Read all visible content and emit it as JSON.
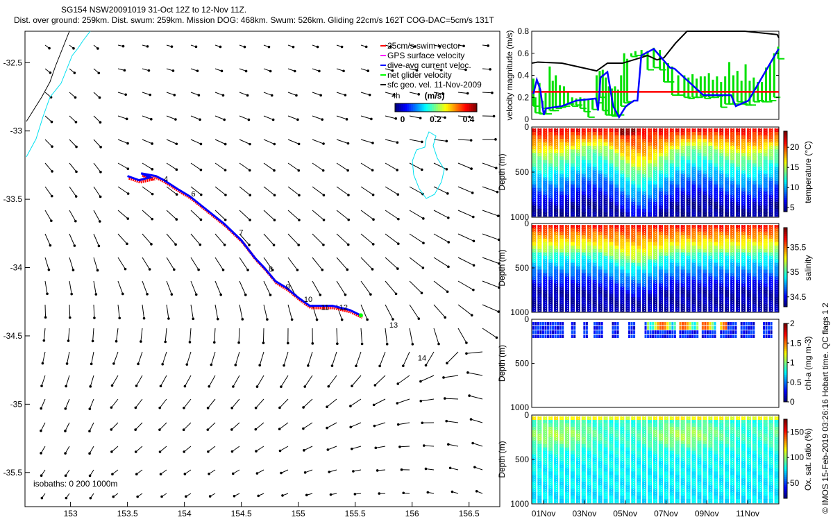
{
  "title": {
    "line1": "SG154 NSW20091019 31-Oct 12Z to 12-Nov 11Z.",
    "line2": "Dist. over ground: 259km. Dist. swum: 259km. Mission DOG: 468km. Swum: 526km. Gliding 22cm/s 162T COG-DAC=5cm/s 131T"
  },
  "copyright": "© IMOS 15-Feb-2019 03:26:16 Hobart time. QC flags 1  2",
  "chart_data": [
    {
      "type": "line",
      "name": "glider-track-map",
      "xlim": [
        152.6,
        156.77
      ],
      "ylim": [
        -35.75,
        -32.27
      ],
      "xticks": [
        "153",
        "153.5",
        "154",
        "154.5",
        "155",
        "155.5",
        "156",
        "156.5"
      ],
      "xtick_values": [
        153,
        153.5,
        154,
        154.5,
        155,
        155.5,
        156,
        156.5
      ],
      "yticks": [
        "-32.5",
        "-33",
        "-33.5",
        "-34",
        "-34.5",
        "-35",
        "-35.5"
      ],
      "ytick_values": [
        -32.5,
        -33,
        -33.5,
        -34,
        -34.5,
        -35,
        -35.5
      ],
      "track": [
        [
          153.5,
          -33.33
        ],
        [
          153.6,
          -33.36
        ],
        [
          153.7,
          -33.34
        ],
        [
          153.62,
          -33.31
        ],
        [
          153.75,
          -33.33
        ],
        [
          153.82,
          -33.36
        ],
        [
          153.95,
          -33.43
        ],
        [
          154.05,
          -33.48
        ],
        [
          154.2,
          -33.58
        ],
        [
          154.35,
          -33.68
        ],
        [
          154.5,
          -33.8
        ],
        [
          154.62,
          -33.93
        ],
        [
          154.7,
          -34.0
        ],
        [
          154.8,
          -34.1
        ],
        [
          154.9,
          -34.15
        ],
        [
          155.0,
          -34.22
        ],
        [
          155.1,
          -34.28
        ],
        [
          155.3,
          -34.28
        ],
        [
          155.45,
          -34.31
        ],
        [
          155.55,
          -34.35
        ]
      ],
      "day_labels": [
        {
          "text": "4",
          "lon": 153.82,
          "lat": -33.35
        },
        {
          "text": "6",
          "lon": 154.06,
          "lat": -33.46
        },
        {
          "text": "7",
          "lon": 154.48,
          "lat": -33.74
        },
        {
          "text": "8",
          "lon": 154.74,
          "lat": -34.01
        },
        {
          "text": "9",
          "lon": 154.89,
          "lat": -34.14
        },
        {
          "text": "10",
          "lon": 155.05,
          "lat": -34.23
        },
        {
          "text": "11",
          "lon": 155.2,
          "lat": -34.29
        },
        {
          "text": "12",
          "lon": 155.36,
          "lat": -34.29
        },
        {
          "text": "13",
          "lon": 155.8,
          "lat": -34.42
        },
        {
          "text": "14",
          "lon": 156.05,
          "lat": -34.66
        },
        {
          "text": "4h",
          "lon": 155.82,
          "lat": -32.74
        }
      ],
      "legend": [
        {
          "label": "25cm/s swim vector",
          "color": "#ff0000"
        },
        {
          "label": "GPS surface velocity",
          "color": "#ff00ff"
        },
        {
          "label": "dive-avg current veloc.",
          "color": "#0000ff"
        },
        {
          "label": "net glider velocity",
          "color": "#00ff00"
        },
        {
          "label": "sfc geo. vel. 11-Nov-2009",
          "color": "#000000"
        }
      ],
      "legend_position": "top-right",
      "colorbar": {
        "title": "(m/s)",
        "ticks": [
          "0",
          "0.2",
          "0.4"
        ],
        "range": [
          0,
          0.5
        ]
      },
      "isobaths_label": "isobaths: 0   200  1000m"
    },
    {
      "type": "line",
      "name": "velocity-magnitude",
      "ylabel": "velocity magnitude (m/s)",
      "ylim": [
        0,
        0.8
      ],
      "xlim_days": [
        0.42,
        12.53
      ],
      "yticks": [
        "0",
        "0.2",
        "0.4",
        "0.6",
        "0.8"
      ],
      "ytick_values": [
        0,
        0.2,
        0.4,
        0.6,
        0.8
      ],
      "series": [
        {
          "name": "dive-avg current",
          "color": "#0000ff",
          "x": [
            0.5,
            0.67,
            0.84,
            1.01,
            1.12,
            1.9,
            2.6,
            3.56,
            3.67,
            3.79,
            4.13,
            4.41,
            4.7,
            5.04,
            5.43,
            5.6,
            5.79,
            6.4,
            7.19,
            7.42,
            8.83,
            10.19,
            10.42,
            11.04,
            12.52
          ],
          "y": [
            0.23,
            0.36,
            0.27,
            0.04,
            0.1,
            0.12,
            0.17,
            0.19,
            0.08,
            0.38,
            0.43,
            0.12,
            0.02,
            0.12,
            0.17,
            0.17,
            0.58,
            0.64,
            0.47,
            0.46,
            0.22,
            0.22,
            0.12,
            0.17,
            0.64
          ]
        },
        {
          "name": "surface geostrophic",
          "color": "#000000",
          "x": [
            0.42,
            0.72,
            1.9,
            3.6,
            4.13,
            4.87,
            5.77,
            6.1,
            6.56,
            6.9,
            7.46,
            8.03,
            10.86,
            12.45,
            12.53
          ],
          "y": [
            0.51,
            0.52,
            0.51,
            0.44,
            0.51,
            0.51,
            0.56,
            0.58,
            0.54,
            0.56,
            0.69,
            0.8,
            0.8,
            0.77,
            0.74
          ]
        },
        {
          "name": "25cm/s swim",
          "color": "#ff0000",
          "x": [
            0.42,
            12.53
          ],
          "y": [
            0.25,
            0.25
          ]
        },
        {
          "name": "net glider velocity",
          "color": "#00ff00",
          "x": [
            0.5,
            0.6,
            0.8,
            0.95,
            1.1,
            1.3,
            1.45,
            1.6,
            1.8,
            2.0,
            2.2,
            2.4,
            2.6,
            2.8,
            3.0,
            3.2,
            3.4,
            3.6,
            3.75,
            3.9,
            4.05,
            4.2,
            4.35,
            4.5,
            4.65,
            4.8,
            4.95,
            5.1,
            5.3,
            5.5,
            5.8,
            6.1,
            6.4,
            6.7,
            6.9,
            7.1,
            7.3,
            7.6,
            7.9,
            8.1,
            8.3,
            8.5,
            8.7,
            8.9,
            9.1,
            9.3,
            9.5,
            9.7,
            9.9,
            10.1,
            10.3,
            10.5,
            10.7,
            10.9,
            11.1,
            11.3,
            11.5,
            11.7,
            11.9,
            12.1,
            12.3,
            12.5
          ],
          "y": [
            [
              0.12,
              0.37
            ],
            [
              0.06,
              0.2
            ],
            [
              0.05,
              0.33
            ],
            [
              0.1,
              0.17
            ],
            [
              0.05,
              0.24
            ],
            [
              0.08,
              0.48
            ],
            [
              0.08,
              0.35
            ],
            [
              0.1,
              0.4
            ],
            [
              0.11,
              0.31
            ],
            [
              0.12,
              0.3
            ],
            [
              0.14,
              0.25
            ],
            [
              0.12,
              0.2
            ],
            [
              0.13,
              0.19
            ],
            [
              0.1,
              0.2
            ],
            [
              0.07,
              0.19
            ],
            [
              0.02,
              0.18
            ],
            [
              0.09,
              0.19
            ],
            [
              0.15,
              0.4
            ],
            [
              0.2,
              0.44
            ],
            [
              0.08,
              0.45
            ],
            [
              0.04,
              0.38
            ],
            [
              0.04,
              0.3
            ],
            [
              0.03,
              0.28
            ],
            [
              0.04,
              0.3
            ],
            [
              0.04,
              0.27
            ],
            [
              0.12,
              0.4
            ],
            [
              0.15,
              0.6
            ],
            [
              0.16,
              0.55
            ],
            [
              0.57,
              0.6
            ],
            [
              0.58,
              0.62
            ],
            [
              0.58,
              0.63
            ],
            [
              0.45,
              0.62
            ],
            [
              0.47,
              0.65
            ],
            [
              0.45,
              0.63
            ],
            [
              0.34,
              0.52
            ],
            [
              0.34,
              0.51
            ],
            [
              0.22,
              0.48
            ],
            [
              0.22,
              0.4
            ],
            [
              0.2,
              0.4
            ],
            [
              0.19,
              0.38
            ],
            [
              0.2,
              0.41
            ],
            [
              0.2,
              0.37
            ],
            [
              0.21,
              0.39
            ],
            [
              0.19,
              0.39
            ],
            [
              0.2,
              0.42
            ],
            [
              0.2,
              0.36
            ],
            [
              0.21,
              0.39
            ],
            [
              0.11,
              0.34
            ],
            [
              0.14,
              0.39
            ],
            [
              0.14,
              0.52
            ],
            [
              0.14,
              0.4
            ],
            [
              0.16,
              0.44
            ],
            [
              0.14,
              0.35
            ],
            [
              0.13,
              0.5
            ],
            [
              0.13,
              0.35
            ],
            [
              0.16,
              0.38
            ],
            [
              0.17,
              0.34
            ],
            [
              0.16,
              0.34
            ],
            [
              0.16,
              0.47
            ],
            [
              0.17,
              0.5
            ],
            [
              0.2,
              0.6
            ],
            [
              0.55,
              0.66
            ]
          ]
        }
      ]
    },
    {
      "type": "scatter",
      "name": "temperature-section",
      "ylabel": "Depth (m)",
      "yticks": [
        "0",
        "500",
        "1000"
      ],
      "ylim": [
        1000,
        0
      ],
      "colorbar": {
        "label": "temperature (°C)",
        "ticks": [
          "5",
          "10",
          "15",
          "20"
        ],
        "tick_values": [
          5,
          10,
          15,
          20
        ],
        "range": [
          4,
          24
        ]
      }
    },
    {
      "type": "scatter",
      "name": "salinity-section",
      "ylabel": "Depth (m)",
      "yticks": [
        "0",
        "500",
        "1000"
      ],
      "ylim": [
        1000,
        0
      ],
      "colorbar": {
        "label": "salinity",
        "ticks": [
          "34.5",
          "35",
          "35.5"
        ],
        "tick_values": [
          34.5,
          35,
          35.5
        ],
        "range": [
          34.3,
          35.9
        ]
      }
    },
    {
      "type": "scatter",
      "name": "chlorophyll-section",
      "ylabel": "Depth (m)",
      "yticks": [
        "0",
        "500",
        "1000"
      ],
      "ylim": [
        1000,
        0
      ],
      "colorbar": {
        "label": "chl-a (mg m-3)",
        "ticks": [
          "0",
          "0.5",
          "1",
          "1.5",
          "2"
        ],
        "tick_values": [
          0,
          0.5,
          1,
          1.5,
          2
        ],
        "range": [
          0,
          2
        ]
      }
    },
    {
      "type": "scatter",
      "name": "oxygen-section",
      "ylabel": "Depth (m)",
      "yticks": [
        "0",
        "500",
        "1000"
      ],
      "ylim": [
        1000,
        0
      ],
      "colorbar": {
        "label": "Ox. sat. ratio (%)",
        "ticks": [
          "50",
          "100",
          "150"
        ],
        "tick_values": [
          50,
          100,
          150
        ],
        "range": [
          20,
          175
        ]
      }
    }
  ],
  "time_axis": {
    "ticks": [
      "01Nov",
      "03Nov",
      "05Nov",
      "07Nov",
      "09Nov",
      "11Nov"
    ],
    "tick_days": [
      1,
      3,
      5,
      7,
      9,
      11
    ]
  }
}
